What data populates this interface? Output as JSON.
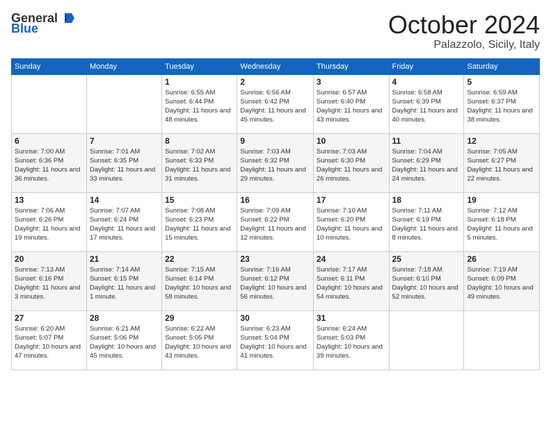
{
  "header": {
    "logo_general": "General",
    "logo_blue": "Blue",
    "month": "October 2024",
    "location": "Palazzolo, Sicily, Italy"
  },
  "weekdays": [
    "Sunday",
    "Monday",
    "Tuesday",
    "Wednesday",
    "Thursday",
    "Friday",
    "Saturday"
  ],
  "weeks": [
    [
      {
        "day": "",
        "info": ""
      },
      {
        "day": "",
        "info": ""
      },
      {
        "day": "1",
        "info": "Sunrise: 6:55 AM\nSunset: 6:44 PM\nDaylight: 11 hours and 48 minutes."
      },
      {
        "day": "2",
        "info": "Sunrise: 6:56 AM\nSunset: 6:42 PM\nDaylight: 11 hours and 45 minutes."
      },
      {
        "day": "3",
        "info": "Sunrise: 6:57 AM\nSunset: 6:40 PM\nDaylight: 11 hours and 43 minutes."
      },
      {
        "day": "4",
        "info": "Sunrise: 6:58 AM\nSunset: 6:39 PM\nDaylight: 11 hours and 40 minutes."
      },
      {
        "day": "5",
        "info": "Sunrise: 6:59 AM\nSunset: 6:37 PM\nDaylight: 11 hours and 38 minutes."
      }
    ],
    [
      {
        "day": "6",
        "info": "Sunrise: 7:00 AM\nSunset: 6:36 PM\nDaylight: 11 hours and 36 minutes."
      },
      {
        "day": "7",
        "info": "Sunrise: 7:01 AM\nSunset: 6:35 PM\nDaylight: 11 hours and 33 minutes."
      },
      {
        "day": "8",
        "info": "Sunrise: 7:02 AM\nSunset: 6:33 PM\nDaylight: 11 hours and 31 minutes."
      },
      {
        "day": "9",
        "info": "Sunrise: 7:03 AM\nSunset: 6:32 PM\nDaylight: 11 hours and 29 minutes."
      },
      {
        "day": "10",
        "info": "Sunrise: 7:03 AM\nSunset: 6:30 PM\nDaylight: 11 hours and 26 minutes."
      },
      {
        "day": "11",
        "info": "Sunrise: 7:04 AM\nSunset: 6:29 PM\nDaylight: 11 hours and 24 minutes."
      },
      {
        "day": "12",
        "info": "Sunrise: 7:05 AM\nSunset: 6:27 PM\nDaylight: 11 hours and 22 minutes."
      }
    ],
    [
      {
        "day": "13",
        "info": "Sunrise: 7:06 AM\nSunset: 6:26 PM\nDaylight: 11 hours and 19 minutes."
      },
      {
        "day": "14",
        "info": "Sunrise: 7:07 AM\nSunset: 6:24 PM\nDaylight: 11 hours and 17 minutes."
      },
      {
        "day": "15",
        "info": "Sunrise: 7:08 AM\nSunset: 6:23 PM\nDaylight: 11 hours and 15 minutes."
      },
      {
        "day": "16",
        "info": "Sunrise: 7:09 AM\nSunset: 6:22 PM\nDaylight: 11 hours and 12 minutes."
      },
      {
        "day": "17",
        "info": "Sunrise: 7:10 AM\nSunset: 6:20 PM\nDaylight: 11 hours and 10 minutes."
      },
      {
        "day": "18",
        "info": "Sunrise: 7:11 AM\nSunset: 6:19 PM\nDaylight: 11 hours and 8 minutes."
      },
      {
        "day": "19",
        "info": "Sunrise: 7:12 AM\nSunset: 6:18 PM\nDaylight: 11 hours and 5 minutes."
      }
    ],
    [
      {
        "day": "20",
        "info": "Sunrise: 7:13 AM\nSunset: 6:16 PM\nDaylight: 11 hours and 3 minutes."
      },
      {
        "day": "21",
        "info": "Sunrise: 7:14 AM\nSunset: 6:15 PM\nDaylight: 11 hours and 1 minute."
      },
      {
        "day": "22",
        "info": "Sunrise: 7:15 AM\nSunset: 6:14 PM\nDaylight: 10 hours and 58 minutes."
      },
      {
        "day": "23",
        "info": "Sunrise: 7:16 AM\nSunset: 6:12 PM\nDaylight: 10 hours and 56 minutes."
      },
      {
        "day": "24",
        "info": "Sunrise: 7:17 AM\nSunset: 6:11 PM\nDaylight: 10 hours and 54 minutes."
      },
      {
        "day": "25",
        "info": "Sunrise: 7:18 AM\nSunset: 6:10 PM\nDaylight: 10 hours and 52 minutes."
      },
      {
        "day": "26",
        "info": "Sunrise: 7:19 AM\nSunset: 6:09 PM\nDaylight: 10 hours and 49 minutes."
      }
    ],
    [
      {
        "day": "27",
        "info": "Sunrise: 6:20 AM\nSunset: 5:07 PM\nDaylight: 10 hours and 47 minutes."
      },
      {
        "day": "28",
        "info": "Sunrise: 6:21 AM\nSunset: 5:06 PM\nDaylight: 10 hours and 45 minutes."
      },
      {
        "day": "29",
        "info": "Sunrise: 6:22 AM\nSunset: 5:05 PM\nDaylight: 10 hours and 43 minutes."
      },
      {
        "day": "30",
        "info": "Sunrise: 6:23 AM\nSunset: 5:04 PM\nDaylight: 10 hours and 41 minutes."
      },
      {
        "day": "31",
        "info": "Sunrise: 6:24 AM\nSunset: 5:03 PM\nDaylight: 10 hours and 39 minutes."
      },
      {
        "day": "",
        "info": ""
      },
      {
        "day": "",
        "info": ""
      }
    ]
  ]
}
